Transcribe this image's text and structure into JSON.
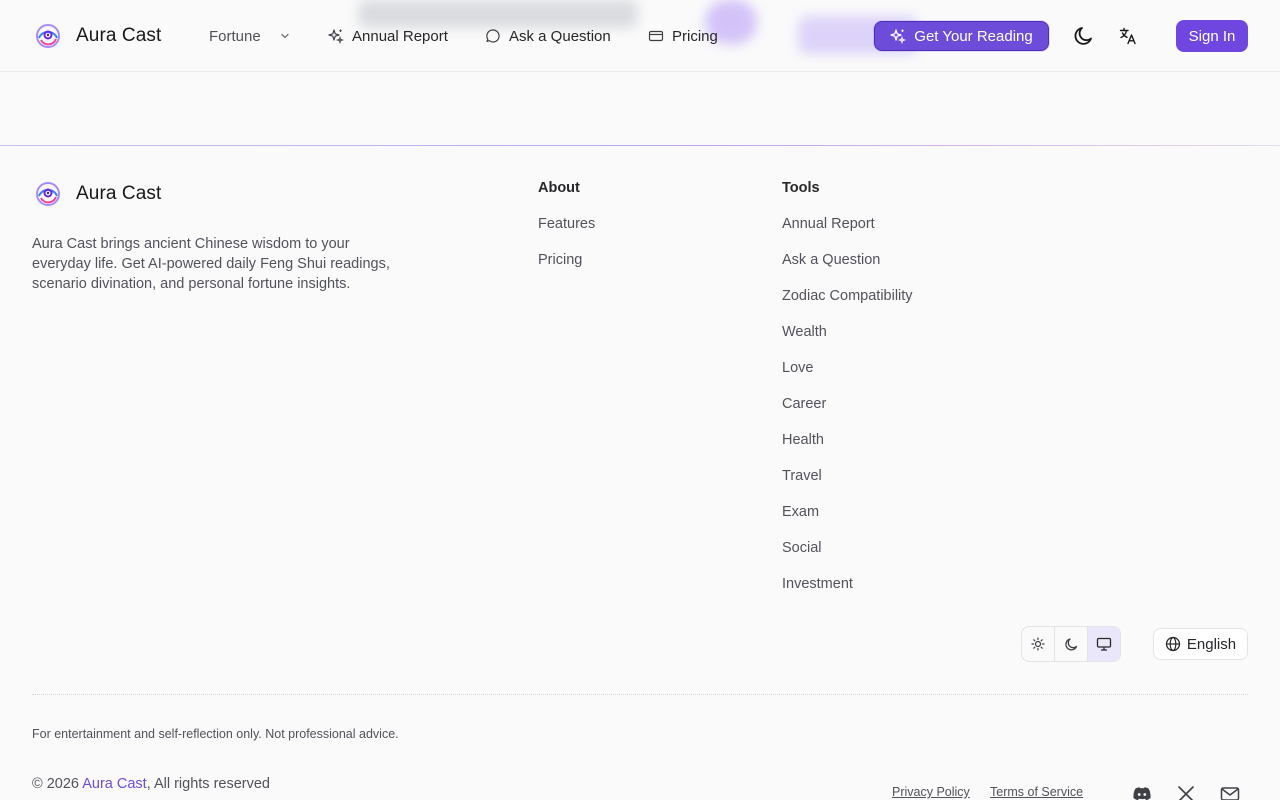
{
  "header": {
    "brand": "Aura Cast",
    "nav": {
      "fortune": "Fortune",
      "annual_report": "Annual Report",
      "ask_question": "Ask a Question",
      "pricing": "Pricing"
    },
    "cta_label": "Get Your Reading",
    "signin_label": "Sign In"
  },
  "footer": {
    "brand": "Aura Cast",
    "description": "Aura Cast brings ancient Chinese wisdom to your everyday life. Get AI-powered daily Feng Shui readings, scenario divination, and personal fortune insights.",
    "about": {
      "title": "About",
      "links": [
        "Features",
        "Pricing"
      ]
    },
    "tools": {
      "title": "Tools",
      "links": [
        "Annual Report",
        "Ask a Question",
        "Zodiac Compatibility",
        "Wealth",
        "Love",
        "Career",
        "Health",
        "Travel",
        "Exam",
        "Social",
        "Investment"
      ]
    },
    "theme": {
      "options": [
        "light",
        "dark",
        "system"
      ],
      "selected": "system"
    },
    "language": "English",
    "disclaimer": "For entertainment and self-reflection only. Not professional advice.",
    "copyright_prefix": "© 2026 ",
    "copyright_brand": "Aura Cast",
    "copyright_suffix": ", All rights reserved",
    "legal": {
      "privacy": "Privacy Policy",
      "terms": "Terms of Service"
    },
    "social_icons": [
      "discord-icon",
      "x-icon",
      "mail-icon"
    ]
  },
  "colors": {
    "accent": "#6d4cd9",
    "signin_bg": "#6f46e0",
    "text": "#27272a",
    "muted": "#52525b",
    "background": "#fafafa"
  }
}
